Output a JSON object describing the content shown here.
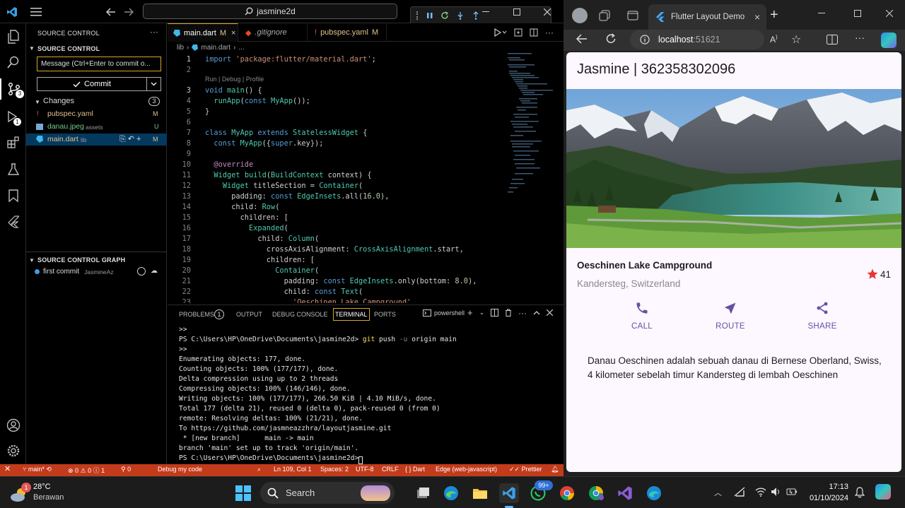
{
  "vscode": {
    "search_text": "jasmine2d",
    "sidebar": {
      "view_title": "SOURCE CONTROL",
      "section_title": "SOURCE CONTROL",
      "message_placeholder": "Message (Ctrl+Enter to commit o...",
      "commit_label": "Commit",
      "changes_label": "Changes",
      "changes_count": "3",
      "files": [
        {
          "name": "pubspec.yaml",
          "folder": "",
          "status": "M"
        },
        {
          "name": "danau.jpeg",
          "folder": "assets",
          "status": "U"
        },
        {
          "name": "main.dart",
          "folder": "lib",
          "status": "M"
        }
      ],
      "graph_title": "SOURCE CONTROL GRAPH",
      "graph_commit": "first commit",
      "graph_author": "JasmineAz"
    },
    "tabs": [
      {
        "label": "main.dart",
        "status": "M",
        "active": true
      },
      {
        "label": ".gitignore",
        "status": "",
        "active": false
      },
      {
        "label": "pubspec.yaml",
        "status": "M",
        "active": false
      }
    ],
    "breadcrumb": {
      "folder": "lib",
      "file": "main.dart",
      "more": "..."
    },
    "codelens": "Run | Debug | Profile",
    "code_lines": [
      {
        "n": "1",
        "t": "import 'package:flutter/material.dart';"
      },
      {
        "n": "2",
        "t": ""
      },
      {
        "n": "3",
        "t": "void main() {"
      },
      {
        "n": "4",
        "t": "  runApp(const MyApp());"
      },
      {
        "n": "5",
        "t": "}"
      },
      {
        "n": "6",
        "t": ""
      },
      {
        "n": "7",
        "t": "class MyApp extends StatelessWidget {"
      },
      {
        "n": "8",
        "t": "  const MyApp({super.key});"
      },
      {
        "n": "9",
        "t": ""
      },
      {
        "n": "10",
        "t": "  @override"
      },
      {
        "n": "11",
        "t": "  Widget build(BuildContext context) {"
      },
      {
        "n": "12",
        "t": "    Widget titleSection = Container("
      },
      {
        "n": "13",
        "t": "      padding: const EdgeInsets.all(16.0),"
      },
      {
        "n": "14",
        "t": "      child: Row("
      },
      {
        "n": "15",
        "t": "        children: ["
      },
      {
        "n": "16",
        "t": "          Expanded("
      },
      {
        "n": "17",
        "t": "            child: Column("
      },
      {
        "n": "18",
        "t": "              crossAxisAlignment: CrossAxisAlignment.start,"
      },
      {
        "n": "19",
        "t": "              children: ["
      },
      {
        "n": "20",
        "t": "                Container("
      },
      {
        "n": "21",
        "t": "                  padding: const EdgeInsets.only(bottom: 8.0),"
      },
      {
        "n": "22",
        "t": "                  child: const Text("
      },
      {
        "n": "23",
        "t": "                    'Oeschinen Lake Campground',"
      }
    ],
    "panel": {
      "tabs": [
        "PROBLEMS",
        "OUTPUT",
        "DEBUG CONSOLE",
        "TERMINAL",
        "PORTS"
      ],
      "problems_count": "1",
      "shell": "powershell",
      "terminal_lines": [
        ">>",
        "PS C:\\Users\\HP\\OneDrive\\Documents\\jasmine2d> git push -u origin main",
        ">>",
        "Enumerating objects: 177, done.",
        "Counting objects: 100% (177/177), done.",
        "Delta compression using up to 2 threads",
        "Compressing objects: 100% (146/146), done.",
        "Writing objects: 100% (177/177), 266.50 KiB | 4.10 MiB/s, done.",
        "Total 177 (delta 21), reused 0 (delta 0), pack-reused 0 (from 0)",
        "remote: Resolving deltas: 100% (21/21), done.",
        "To https://github.com/jasmneazzhra/layoutjasmine.git",
        " * [new branch]      main -> main",
        "branch 'main' set up to track 'origin/main'.",
        "PS C:\\Users\\HP\\OneDrive\\Documents\\jasmine2d> "
      ]
    },
    "status": {
      "branch": "main*",
      "errors": "0",
      "warnings": "0",
      "info": "1",
      "ports": "0",
      "debug": "Debug my code",
      "position": "Ln 109, Col 1",
      "spaces": "Spaces: 2",
      "encoding": "UTF-8",
      "eol": "CRLF",
      "language": "Dart",
      "device": "Edge (web-javascript)",
      "prettier": "Prettier"
    }
  },
  "browser": {
    "tab_title": "Flutter Layout Demo",
    "url_host": "localhost",
    "url_port": ":51621",
    "app": {
      "appbar_title": "Jasmine | 362358302096",
      "place_title": "Oeschinen Lake Campground",
      "place_subtitle": "Kandersteg, Switzerland",
      "star_count": "41",
      "buttons": [
        {
          "label": "CALL",
          "icon": "phone-icon"
        },
        {
          "label": "ROUTE",
          "icon": "near-me-icon"
        },
        {
          "label": "SHARE",
          "icon": "share-icon"
        }
      ],
      "description": "Danau Oeschinen adalah sebuah danau di Bernese Oberland, Swiss, 4 kilometer sebelah timur Kandersteg di lembah Oeschinen",
      "accent_color": "#6750a4",
      "star_color": "#e53935"
    }
  },
  "taskbar": {
    "weather_temp": "28°C",
    "weather_desc": "Berawan",
    "weather_badge": "1",
    "search_label": "Search",
    "whatsapp_badge": "99+",
    "time": "17:13",
    "date": "01/10/2024"
  }
}
